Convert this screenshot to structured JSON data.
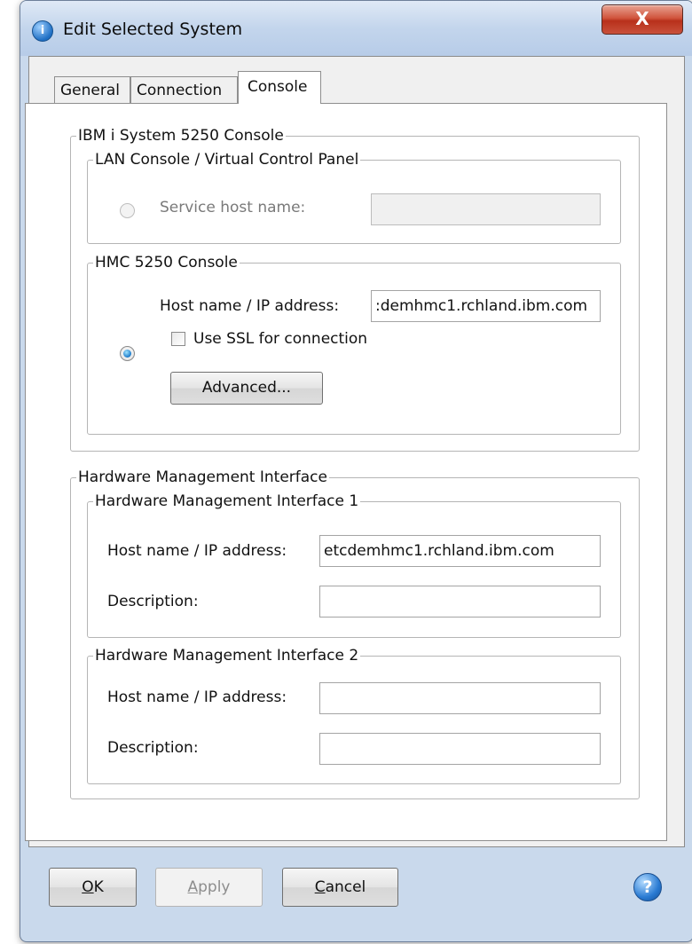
{
  "window": {
    "title": "Edit Selected System",
    "close_glyph": "X",
    "app_icon_glyph": "i"
  },
  "tabs": [
    {
      "label": "General",
      "active": false
    },
    {
      "label": "Connection",
      "active": false
    },
    {
      "label": "Console",
      "active": true
    }
  ],
  "console": {
    "group_title": "IBM i System 5250 Console",
    "lan": {
      "group_title": "LAN Console / Virtual Control Panel",
      "radio_label": "Service host name:",
      "value": ""
    },
    "hmc5250": {
      "group_title": "HMC 5250 Console",
      "host_label": "Host name / IP address:",
      "host_value": ":demhmc1.rchland.ibm.com",
      "ssl_label": "Use SSL for connection",
      "ssl_checked": false,
      "advanced_label": "Advanced..."
    }
  },
  "hmi": {
    "group_title": "Hardware Management Interface",
    "interface1": {
      "group_title": "Hardware Management Interface 1",
      "host_label": "Host name / IP address:",
      "host_value": "etcdemhmc1.rchland.ibm.com",
      "desc_label": "Description:",
      "desc_value": ""
    },
    "interface2": {
      "group_title": "Hardware Management Interface 2",
      "host_label": "Host name / IP address:",
      "host_value": "",
      "desc_label": "Description:",
      "desc_value": ""
    }
  },
  "buttons": {
    "ok_label": "OK",
    "ok_mnemonic": "O",
    "ok_rest": "K",
    "apply_label": "Apply",
    "apply_mnemonic": "A",
    "apply_rest": "pply",
    "cancel_label": "Cancel",
    "cancel_mnemonic": "C",
    "cancel_rest": "ancel",
    "help_glyph": "?"
  }
}
